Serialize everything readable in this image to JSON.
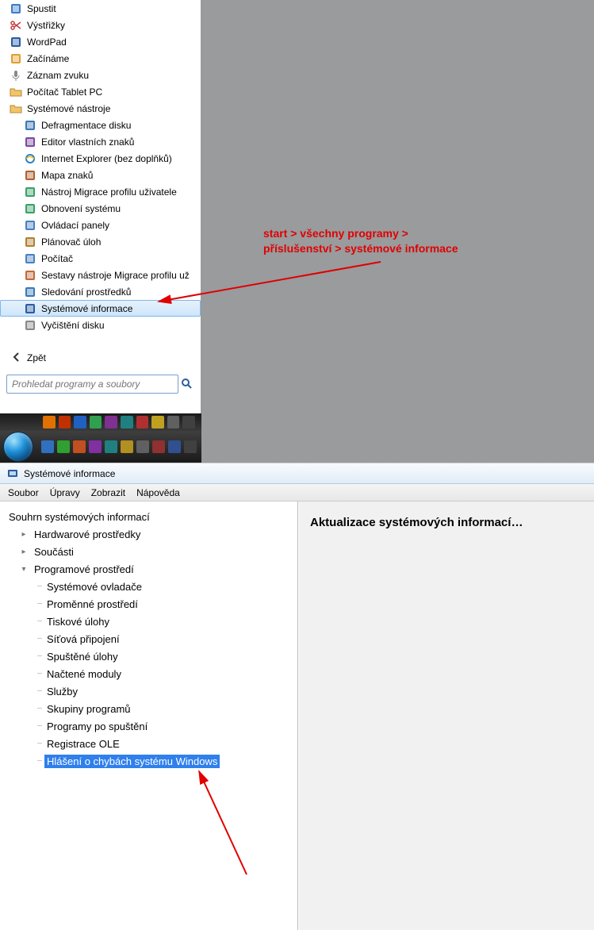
{
  "annotation": {
    "line1": "start > všechny programy >",
    "line2": "příslušenství > systémové informace"
  },
  "start_menu": {
    "search_placeholder": "Prohledat programy a soubory",
    "back_label": "Zpět",
    "items": [
      {
        "label": "Spustit",
        "icon": "app-run",
        "indent": 0
      },
      {
        "label": "Výstřižky",
        "icon": "scissors",
        "indent": 0
      },
      {
        "label": "WordPad",
        "icon": "wordpad",
        "indent": 0
      },
      {
        "label": "Začínáme",
        "icon": "flag",
        "indent": 0
      },
      {
        "label": "Záznam zvuku",
        "icon": "mic",
        "indent": 0
      },
      {
        "label": "Počítač Tablet PC",
        "icon": "folder",
        "indent": 0
      },
      {
        "label": "Systémové nástroje",
        "icon": "folder",
        "indent": 0
      },
      {
        "label": "Defragmentace disku",
        "icon": "defrag",
        "indent": 1
      },
      {
        "label": "Editor vlastních znaků",
        "icon": "char-editor",
        "indent": 1
      },
      {
        "label": "Internet Explorer (bez doplňků)",
        "icon": "ie",
        "indent": 1
      },
      {
        "label": "Mapa znaků",
        "icon": "charmap",
        "indent": 1
      },
      {
        "label": "Nástroj Migrace profilu uživatele",
        "icon": "migrate",
        "indent": 1
      },
      {
        "label": "Obnovení systému",
        "icon": "restore",
        "indent": 1
      },
      {
        "label": "Ovládací panely",
        "icon": "control-panel",
        "indent": 1
      },
      {
        "label": "Plánovač úloh",
        "icon": "scheduler",
        "indent": 1
      },
      {
        "label": "Počítač",
        "icon": "computer",
        "indent": 1
      },
      {
        "label": "Sestavy nástroje Migrace profilu už",
        "icon": "report",
        "indent": 1
      },
      {
        "label": "Sledování prostředků",
        "icon": "resmon",
        "indent": 1
      },
      {
        "label": "Systémové informace",
        "icon": "sysinfo",
        "indent": 1,
        "highlight": true
      },
      {
        "label": "Vyčištění disku",
        "icon": "cleanup",
        "indent": 1
      }
    ]
  },
  "sysinfo": {
    "title": "Systémové informace",
    "menu": {
      "file": "Soubor",
      "edit": "Úpravy",
      "view": "Zobrazit",
      "help": "Nápověda"
    },
    "content_heading": "Aktualizace systémových informací…",
    "tree": {
      "root": "Souhrn systémových informací",
      "hw": "Hardwarové prostředky",
      "components": "Součásti",
      "env": "Programové prostředí",
      "env_children": [
        "Systémové ovladače",
        "Proměnné prostředí",
        "Tiskové úlohy",
        "Síťová připojení",
        "Spuštěné úlohy",
        "Načtené moduly",
        "Služby",
        "Skupiny programů",
        "Programy po spuštění",
        "Registrace OLE",
        "Hlášení o chybách systému Windows"
      ],
      "selected_index": 10
    }
  },
  "icon_colors": {
    "app-run": "#3b7cc4",
    "scissors": "#c43b3b",
    "wordpad": "#2a5ca0",
    "flag": "#e0a030",
    "mic": "#888",
    "folder": "#f3c56b",
    "defrag": "#3a78b5",
    "char-editor": "#7a4aa0",
    "ie": "#2a7fc9",
    "charmap": "#b06030",
    "migrate": "#3aa06a",
    "restore": "#3aa06a",
    "control-panel": "#4a80c0",
    "scheduler": "#b08030",
    "computer": "#4a80c0",
    "report": "#c06a3a",
    "resmon": "#3a78b5",
    "sysinfo": "#2a5ca0",
    "cleanup": "#888"
  },
  "tray_colors": [
    "#e07000",
    "#c03000",
    "#2060c0",
    "#30a050",
    "#803090",
    "#208080",
    "#b03030",
    "#c0a020",
    "#606060",
    "#404040"
  ],
  "taskbar_colors": [
    "#3070c0",
    "#30a030",
    "#c05020",
    "#8030a0",
    "#208080",
    "#b09020",
    "#606060",
    "#903030",
    "#305090",
    "#404040"
  ]
}
